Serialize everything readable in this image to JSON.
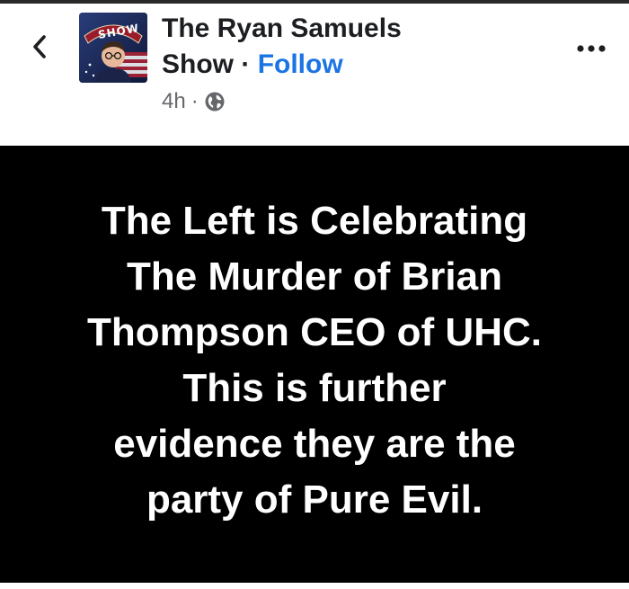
{
  "header": {
    "back_icon": "chevron-left-icon",
    "avatar_text": "SHOW",
    "page_name_line1": "The Ryan Samuels",
    "page_name_line2": "Show",
    "separator": "·",
    "follow_label": "Follow",
    "timestamp": "4h",
    "meta_separator": "·",
    "privacy_icon": "globe-icon",
    "more_icon": "more-horizontal-icon",
    "accent_color": "#1b74e4"
  },
  "post": {
    "background_color": "#000000",
    "text_color": "#ffffff",
    "lines": [
      "The Left is Celebrating",
      "The Murder of Brian",
      "Thompson CEO of UHC.",
      "This is further",
      "evidence they are the",
      "party of Pure Evil."
    ]
  }
}
